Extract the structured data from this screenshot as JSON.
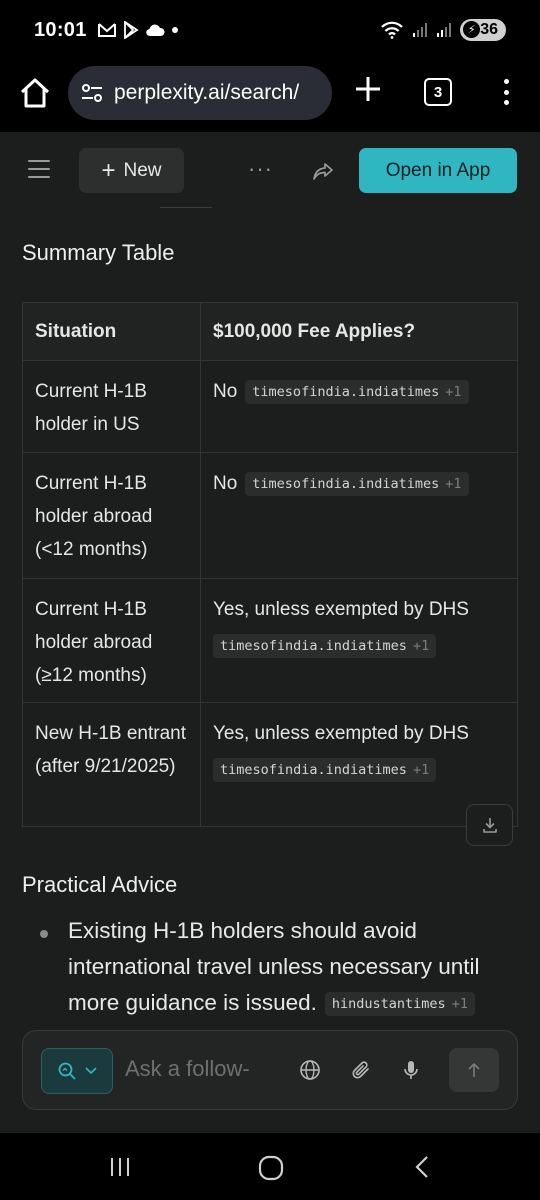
{
  "status_bar": {
    "time": "10:01",
    "battery": "36"
  },
  "browser": {
    "url": "perplexity.ai/search/",
    "tab_count": "3"
  },
  "header": {
    "new_label": "New",
    "more_label": "···",
    "open_in_app_label": "Open in App"
  },
  "summary": {
    "title": "Summary Table",
    "columns": [
      "Situation",
      "$100,000 Fee Applies?"
    ],
    "rows": [
      {
        "situation": "Current H-1B holder in US",
        "answer": "No",
        "cite": "timesofindia.indiatimes",
        "cite_extra": "+1"
      },
      {
        "situation": "Current H-1B holder abroad (<12 months)",
        "answer": "No",
        "cite": "timesofindia.indiatimes",
        "cite_extra": "+1"
      },
      {
        "situation": "Current H-1B holder abroad (≥12 months)",
        "answer": "Yes, unless exempted by DHS",
        "cite": "timesofindia.indiatimes",
        "cite_extra": "+1"
      },
      {
        "situation": "New H-1B entrant (after 9/21/2025)",
        "answer": "Yes, unless exempted by DHS",
        "cite": "timesofindia.indiatimes",
        "cite_extra": "+1"
      }
    ]
  },
  "advice": {
    "title": "Practical Advice",
    "items": [
      {
        "text": "Existing H-1B holders should avoid international travel unless necessary until more guidance is issued.",
        "cite": "hindustantimes",
        "cite_extra": "+1"
      }
    ]
  },
  "ask_bar": {
    "placeholder": "Ask a follow-"
  },
  "colors": {
    "accent": "#2fb6c1",
    "background": "#1c1d1d"
  }
}
